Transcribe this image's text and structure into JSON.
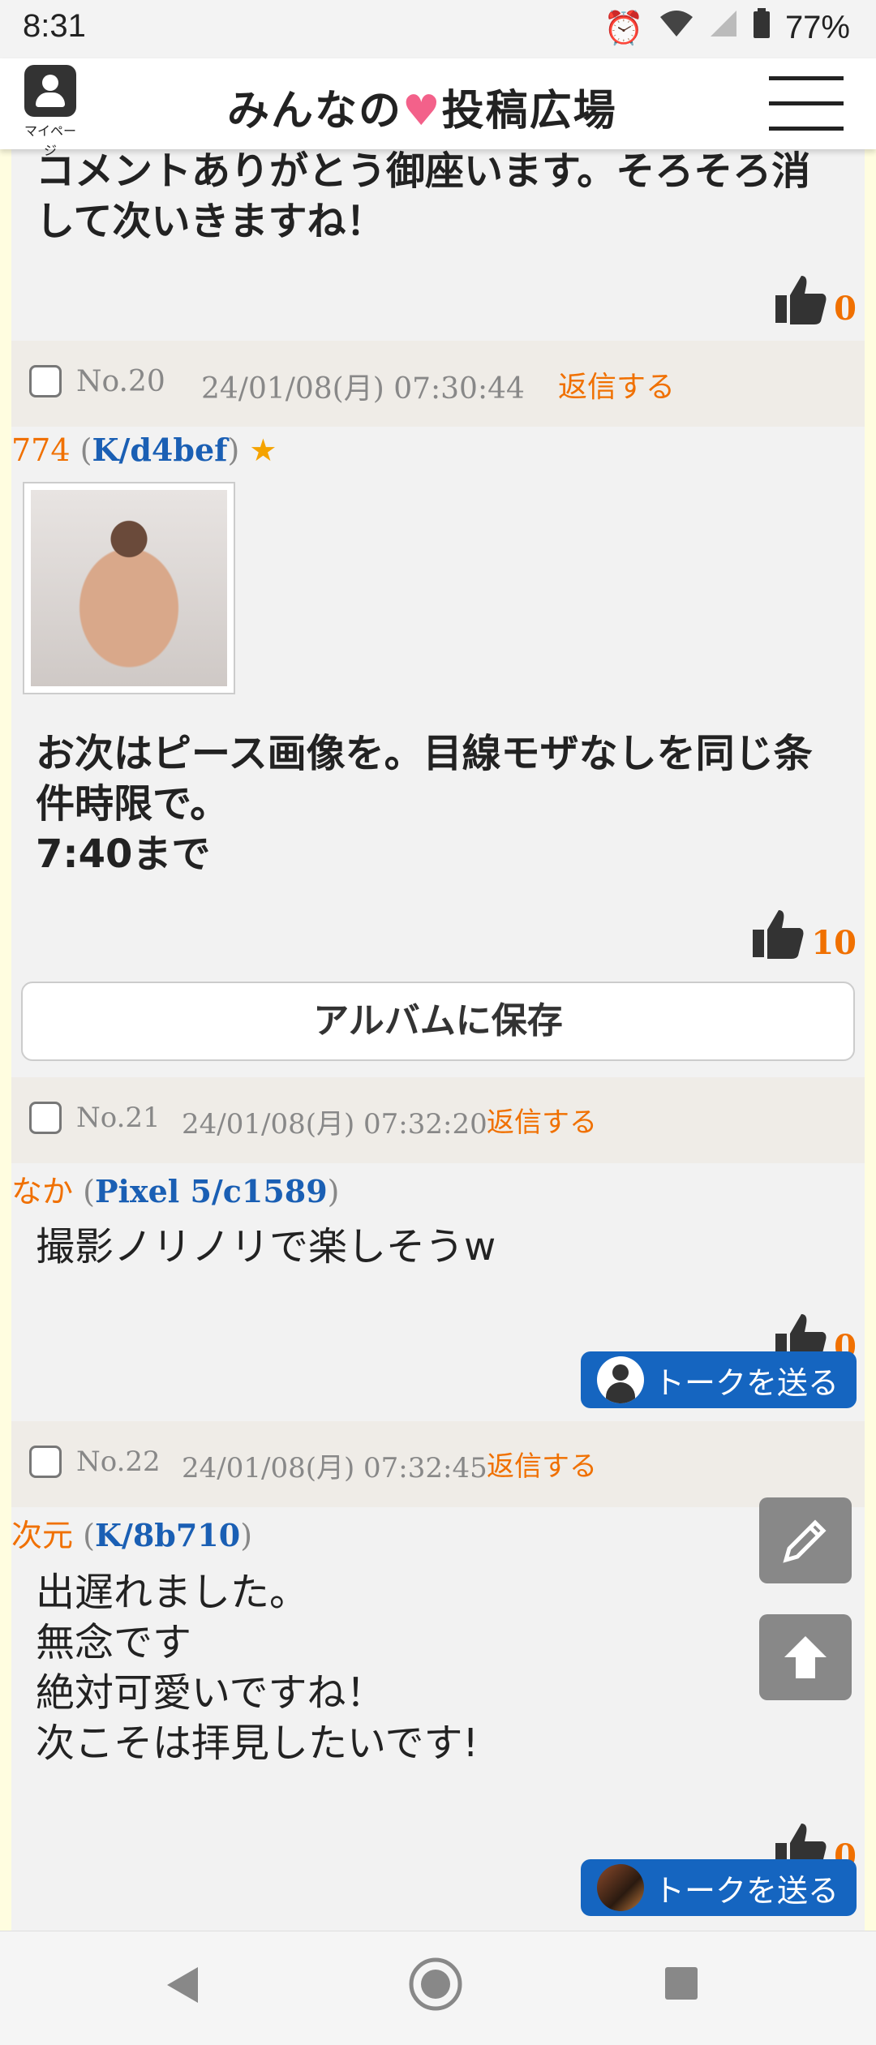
{
  "status_bar": {
    "time": "8:31",
    "battery": "77%"
  },
  "header": {
    "mypage_label": "マイページ",
    "logo_left": "みんなの",
    "logo_right": "投稿広場"
  },
  "posts": [
    {
      "body": "コメントありがとう御座います。そろそろ消して次いきますね！",
      "likes": "0"
    },
    {
      "no": "No.20",
      "date": "24/01/08(月) 07:30:44",
      "reply": "返信する",
      "name": "774",
      "id": "K/d4bef",
      "star": "★",
      "body": "お次はピース画像を。目線モザなしを同じ条件時限で。\n7:40まで",
      "likes": "10",
      "album": "アルバムに保存"
    },
    {
      "no": "No.21",
      "date": "24/01/08(月) 07:32:20",
      "reply": "返信する",
      "name": "なか",
      "id": "Pixel 5/c1589",
      "body": "撮影ノリノリで楽しそうw",
      "likes": "0",
      "talk": "トークを送る"
    },
    {
      "no": "No.22",
      "date": "24/01/08(月) 07:32:45",
      "reply": "返信する",
      "name": "次元",
      "id": "K/8b710",
      "body": "出遅れました。\n無念です\n絶対可愛いですね！\n次こそは拝見したいです!",
      "likes": "0",
      "talk": "トークを送る"
    }
  ]
}
